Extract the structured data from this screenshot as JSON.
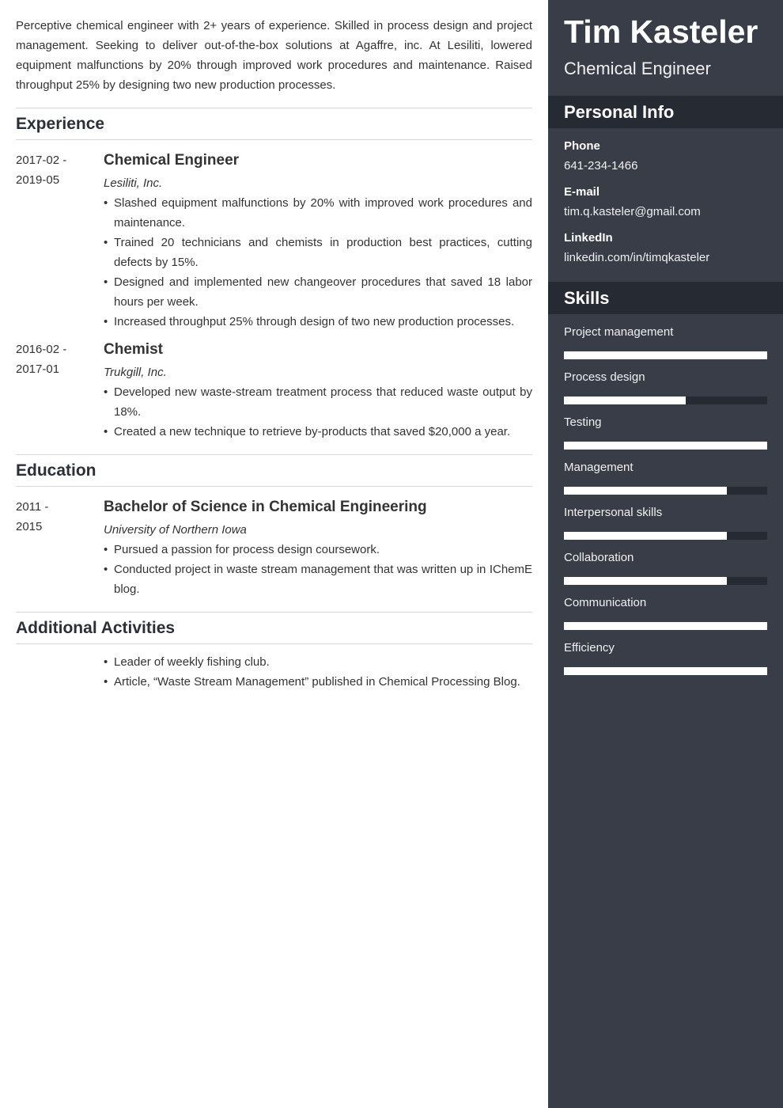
{
  "summary": "Perceptive chemical engineer with 2+ years of experience. Skilled in process design and project management. Seeking to deliver out-of-the-box solutions at Agaffre, inc. At Lesiliti, lowered equipment malfunctions by 20% through improved work procedures and maintenance. Raised throughput 25% by designing two new production processes.",
  "sections": {
    "experience": "Experience",
    "education": "Education",
    "activities": "Additional Activities"
  },
  "experience": [
    {
      "date_start": "2017-02 -",
      "date_end": "2019-05",
      "title": "Chemical Engineer",
      "org": "Lesiliti, Inc.",
      "bullets": [
        "Slashed equipment malfunctions by 20% with improved work procedures and maintenance.",
        "Trained 20 technicians and chemists in production best practices, cutting defects by 15%.",
        "Designed and implemented new changeover procedures that saved 18 labor hours per week.",
        "Increased throughput 25% through design of two new production processes."
      ]
    },
    {
      "date_start": "2016-02 -",
      "date_end": "2017-01",
      "title": "Chemist",
      "org": "Trukgill, Inc.",
      "bullets": [
        "Developed new waste-stream treatment process that reduced waste output by 18%.",
        "Created a new technique to retrieve by-products that saved $20,000 a year."
      ]
    }
  ],
  "education": [
    {
      "date_start": "2011 -",
      "date_end": "2015",
      "title": "Bachelor of Science in Chemical Engineering",
      "org": "University of Northern Iowa",
      "bullets": [
        "Pursued a passion for process design coursework.",
        "Conducted project in waste stream management that was written up in IChemE blog."
      ]
    }
  ],
  "activities": {
    "bullets": [
      "Leader of weekly fishing club.",
      "Article, “Waste Stream Management” published in Chemical Processing Blog."
    ]
  },
  "bullet_glyph": "•",
  "sidebar": {
    "name": "Tim Kasteler",
    "role": "Chemical Engineer",
    "personal_info_heading": "Personal Info",
    "info": [
      {
        "label": "Phone",
        "value": "641-234-1466"
      },
      {
        "label": "E-mail",
        "value": "tim.q.kasteler@gmail.com"
      },
      {
        "label": "LinkedIn",
        "value": "linkedin.com/in/timqkasteler"
      }
    ],
    "skills_heading": "Skills",
    "skills": [
      {
        "name": "Project management",
        "level": 1.0
      },
      {
        "name": "Process design",
        "level": 0.6
      },
      {
        "name": "Testing",
        "level": 1.0
      },
      {
        "name": "Management",
        "level": 0.8
      },
      {
        "name": "Interpersonal skills",
        "level": 0.8
      },
      {
        "name": "Collaboration",
        "level": 0.8
      },
      {
        "name": "Communication",
        "level": 1.0
      },
      {
        "name": "Efficiency",
        "level": 1.0
      }
    ]
  },
  "colors": {
    "sidebar_bg": "#383d48",
    "sidebar_heading_bg": "#262a33",
    "skill_fill": "#ffffff",
    "skill_track": "#262a33"
  }
}
